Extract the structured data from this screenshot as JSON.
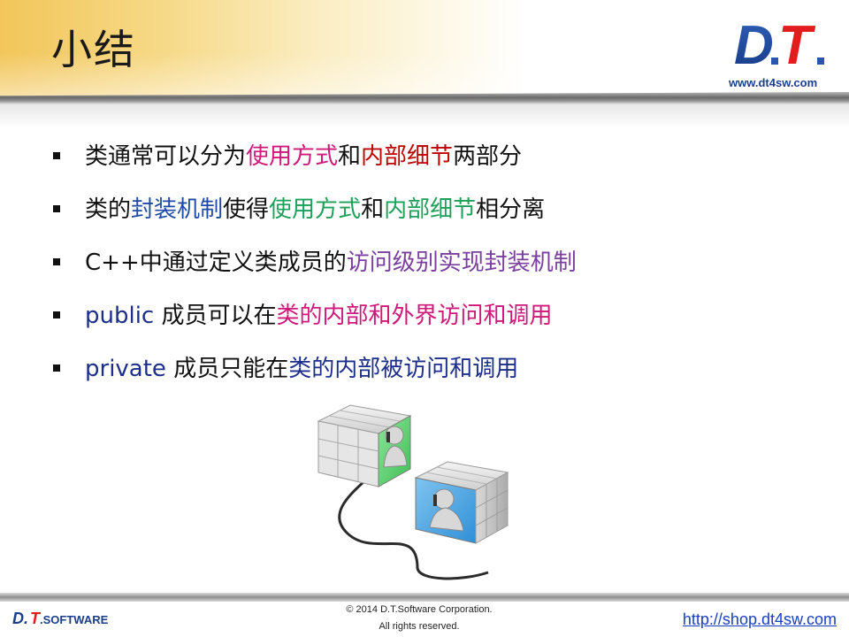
{
  "slide": {
    "title": "小结",
    "logo_text": "D.T.",
    "site": "www.dt4sw.com"
  },
  "colors": {
    "magenta": "#d0187a",
    "red": "#c00000",
    "blue": "#1f4aa6",
    "green": "#1ea05a",
    "purple": "#7b3fa0",
    "navy": "#1c2f8a"
  },
  "bullets": [
    {
      "segments": [
        "类通常可以分为",
        "使用方式",
        "和",
        "内部细节",
        "两部分"
      ]
    },
    {
      "segments": [
        "类的",
        "封装机制",
        "使得",
        "使用方式",
        "和",
        "内部细节",
        "相分离"
      ]
    },
    {
      "segments": [
        "C++中通过定义类成员的",
        "访问级别实现封装机制"
      ]
    },
    {
      "segments": [
        "public",
        " 成员可以在",
        "类的内部和外界访问和调用"
      ]
    },
    {
      "segments": [
        "private",
        " 成员只能在",
        "类的内部被访问和调用"
      ]
    }
  ],
  "illustration": {
    "icon": "two-cubes-phone-call-illustration"
  },
  "footer": {
    "logo_text": "D.T.SOFTWARE",
    "copyright": "© 2014 D.T.Software Corporation.",
    "rights": "All rights reserved.",
    "link": "http://shop.dt4sw.com"
  }
}
